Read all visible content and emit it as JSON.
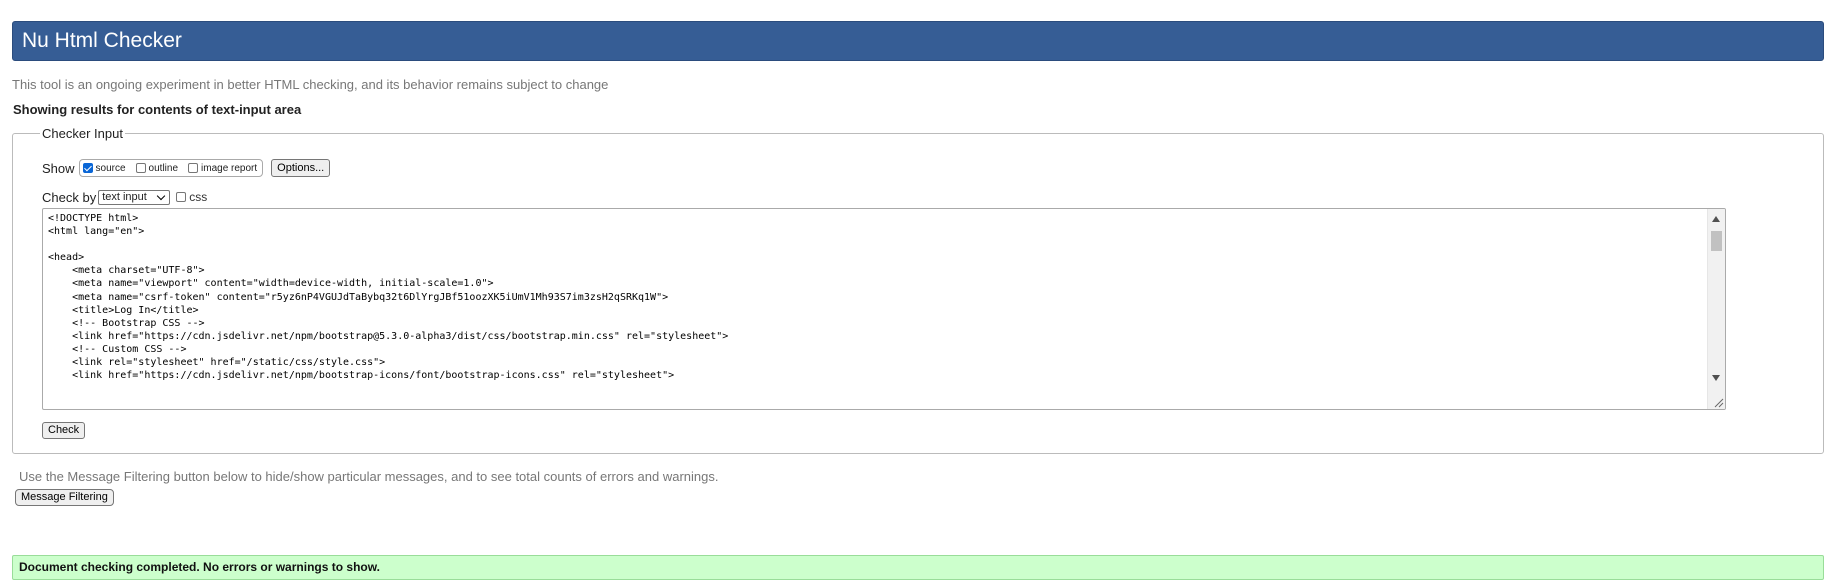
{
  "header": {
    "title": "Nu Html Checker"
  },
  "tagline": "This tool is an ongoing experiment in better HTML checking, and its behavior remains subject to change",
  "results_for": "Showing results for contents of text-input area",
  "checker": {
    "legend": "Checker Input",
    "show_label": "Show",
    "show_options": [
      {
        "label": "source",
        "checked": true
      },
      {
        "label": "outline",
        "checked": false
      },
      {
        "label": "image report",
        "checked": false
      }
    ],
    "options_button": "Options...",
    "check_by_label": "Check by",
    "check_by_value": "text input",
    "css_label": "css",
    "css_checked": false,
    "code": "<!DOCTYPE html>\n<html lang=\"en\">\n\n<head>\n    <meta charset=\"UTF-8\">\n    <meta name=\"viewport\" content=\"width=device-width, initial-scale=1.0\">\n    <meta name=\"csrf-token\" content=\"r5yz6nP4VGUJdTaBybq32t6DlYrgJBf51oozXK5iUmV1Mh93S7im3zsH2qSRKq1W\">\n    <title>Log In</title>\n    <!-- Bootstrap CSS -->\n    <link href=\"https://cdn.jsdelivr.net/npm/bootstrap@5.3.0-alpha3/dist/css/bootstrap.min.css\" rel=\"stylesheet\">\n    <!-- Custom CSS -->\n    <link rel=\"stylesheet\" href=\"/static/css/style.css\">\n    <link href=\"https://cdn.jsdelivr.net/npm/bootstrap-icons/font/bootstrap-icons.css\" rel=\"stylesheet\">",
    "check_button": "Check"
  },
  "filter_note": "Use the Message Filtering button below to hide/show particular messages, and to see total counts of errors and warnings.",
  "filter_button": "Message Filtering",
  "status": "Document checking completed. No errors or warnings to show.",
  "colors": {
    "header_bg": "#365d95",
    "success_bg": "#ccffcc",
    "checkbox_accent": "#0a66d6"
  },
  "icons": {
    "scroll_up": "triangle-up-icon",
    "scroll_down": "triangle-down-icon",
    "resize": "resize-grip-icon",
    "dropdown": "chevron-down-icon"
  }
}
